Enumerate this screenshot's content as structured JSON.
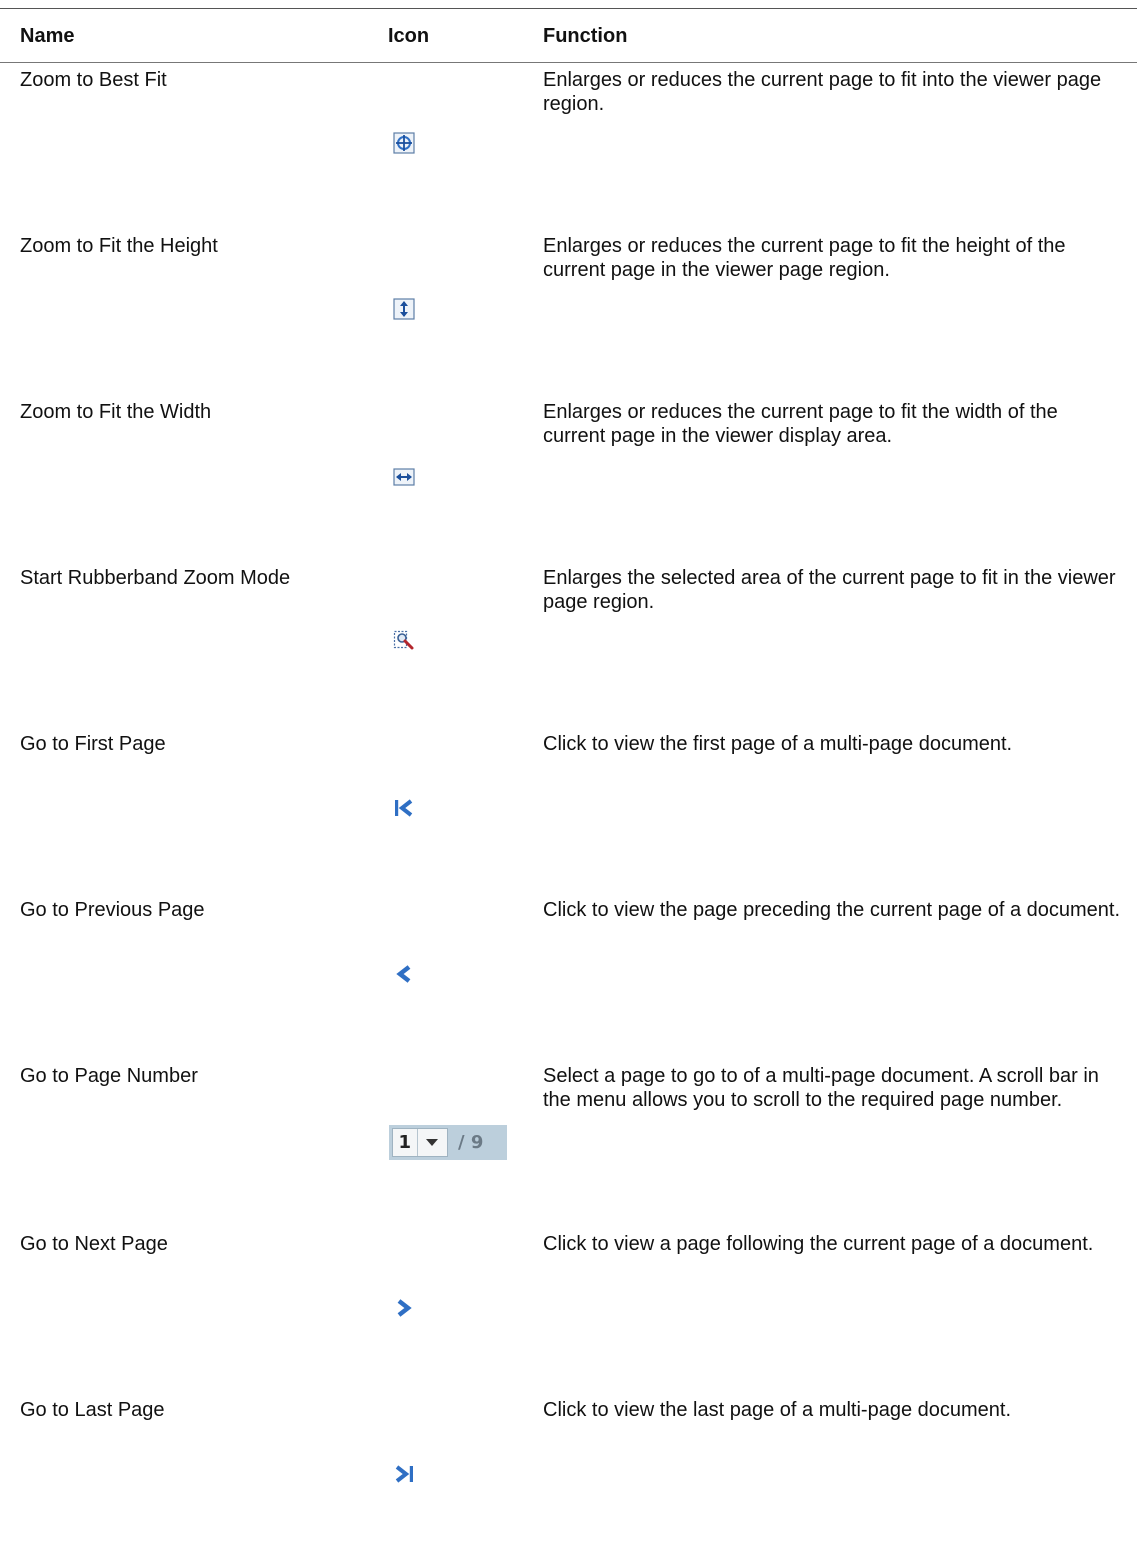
{
  "table": {
    "headers": {
      "name": "Name",
      "icon": "Icon",
      "function": "Function"
    },
    "rows": [
      {
        "name": "Zoom to Best Fit",
        "icon": "zoom-best-fit-icon",
        "function": "Enlarges or reduces the current page to fit into the viewer page region."
      },
      {
        "name": "Zoom to Fit the Height",
        "icon": "zoom-fit-height-icon",
        "function": "Enlarges or reduces the current page to fit the height of the current page in the viewer page region."
      },
      {
        "name": "Zoom to Fit the Width",
        "icon": "zoom-fit-width-icon",
        "function": "Enlarges or reduces the current page to fit the width of the current page in the viewer display area."
      },
      {
        "name": "Start Rubberband Zoom Mode",
        "icon": "rubberband-zoom-icon",
        "function": "Enlarges the selected area of the current page to fit in the viewer page region."
      },
      {
        "name": "Go to First Page",
        "icon": "first-page-icon",
        "function": "Click to view the first page of a multi-page document."
      },
      {
        "name": "Go to Previous Page",
        "icon": "previous-page-icon",
        "function": "Click to view the page preceding the current page of a document."
      },
      {
        "name": "Go to Page Number",
        "icon": "page-number-selector",
        "function": "Select a page to go to of a multi-page document. A scroll bar in the menu allows you to scroll to the required page number.",
        "pager": {
          "current": "1",
          "total": "/ 9"
        }
      },
      {
        "name": "Go to Next Page",
        "icon": "next-page-icon",
        "function": "Click to view a page following the current page of a document."
      },
      {
        "name": "Go to Last Page",
        "icon": "last-page-icon",
        "function": "Click to view the last page of a multi-page document."
      }
    ]
  },
  "colors": {
    "icon_blue": "#2f6fc4",
    "icon_dark_blue": "#1b4f9c",
    "pager_bg": "#bccfdc"
  }
}
